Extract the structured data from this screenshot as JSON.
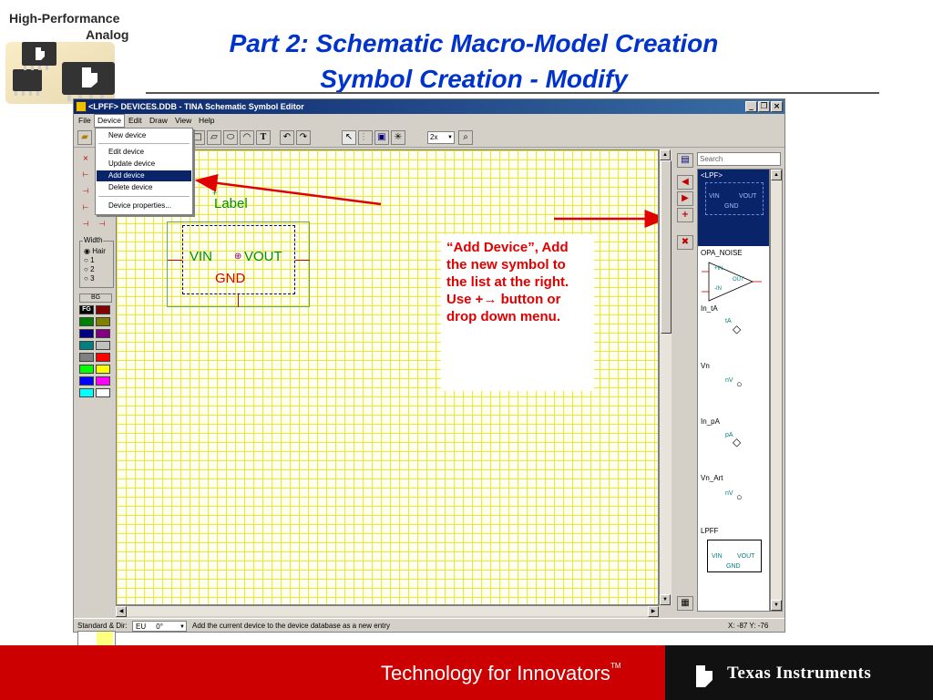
{
  "header": {
    "logo_line1": "High-Performance",
    "logo_line2": "Analog",
    "title_line1": "Part 2: Schematic Macro-Model Creation",
    "title_line2": "Symbol Creation - Modify"
  },
  "window": {
    "title": "<LPFF> DEVICES.DDB - TINA Schematic Symbol Editor",
    "controls": [
      "_",
      "❐",
      "×"
    ]
  },
  "menubar": [
    "File",
    "Device",
    "Edit",
    "Draw",
    "View",
    "Help"
  ],
  "device_menu": {
    "items": [
      "New device",
      "Edit device",
      "Update device",
      "Add device",
      "Delete device",
      "Device properties..."
    ],
    "selected": "Add device"
  },
  "toolbar": {
    "zoom": "2x"
  },
  "palette": {
    "width_label": "Width",
    "width_options": [
      "Hair",
      "1",
      "2",
      "3"
    ],
    "bg_label": "BG",
    "fg_label": "FG",
    "colors": {
      "fg": "#000000",
      "dark_red": "#800000",
      "green": "#008000",
      "olive": "#808000",
      "navy": "#000080",
      "purple": "#800080",
      "teal": "#008080",
      "silver": "#c0c0c0",
      "gray": "#808080",
      "red": "#ff0000",
      "lime": "#00ff00",
      "yellow": "#ffff00",
      "blue": "#0000ff",
      "magenta": "#ff00ff",
      "cyan": "#00ffff",
      "white": "#ffffff"
    }
  },
  "canvas": {
    "label_text": "Label",
    "pin_left": "VIN",
    "pin_right": "VOUT",
    "pin_bottom": "GND"
  },
  "callout": {
    "text": "“Add Device”, Add the new symbol to the list at the right. Use +→ button or drop down menu.",
    "color": "#e00000"
  },
  "device_list": {
    "search_placeholder": "Search",
    "items": [
      {
        "name": "<LPF>",
        "pins": [
          "VIN",
          "VOUT",
          "GND"
        ]
      },
      {
        "name": "OPA_NOISE",
        "pins": [
          "+IN",
          "OUT",
          "-IN"
        ]
      },
      {
        "name": "In_tA",
        "value": "tA"
      },
      {
        "name": "Vn",
        "value": "nV"
      },
      {
        "name": "In_pA",
        "value": "pA"
      },
      {
        "name": "Vn_Art",
        "value": "nV"
      },
      {
        "name": "LPFF",
        "pins": [
          "VIN",
          "VOUT",
          "GND"
        ]
      }
    ]
  },
  "statusbar": {
    "label": "Standard & Dir:",
    "standard": "EU",
    "angle": "0°",
    "message": "Add the current device to the device database as a new entry",
    "coords": "X: -87 Y: -76"
  },
  "footer": {
    "tagline": "Technology for Innovators",
    "trademark": "TM",
    "company": "Texas Instruments"
  }
}
